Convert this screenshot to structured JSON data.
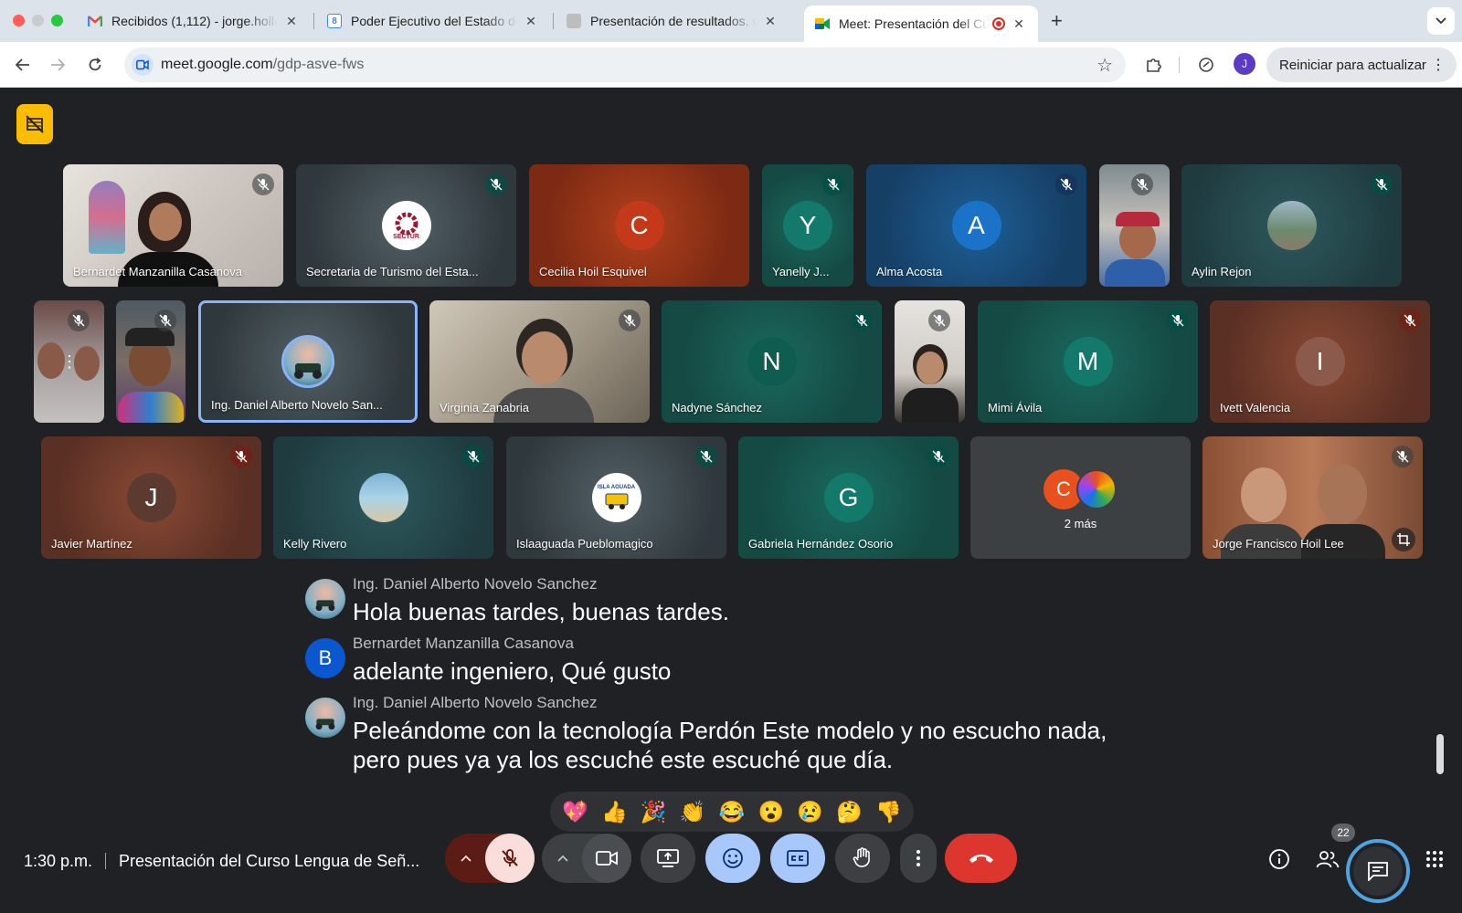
{
  "browser": {
    "tabs": [
      {
        "title": "Recibidos (1,112) - jorge.hoil@",
        "icon": "gmail-icon"
      },
      {
        "title": "Poder Ejecutivo del Estado de",
        "icon": "google-forms-icon"
      },
      {
        "title": "Presentación de resultados. C",
        "icon": "slides-icon"
      },
      {
        "title": "Meet: Presentación del Cu",
        "icon": "meet-icon"
      }
    ],
    "url_domain": "meet.google.com",
    "url_path": "/gdp-asve-fws",
    "profile_initial": "J",
    "update_label": "Reiniciar para actualizar"
  },
  "participants": {
    "row1": [
      {
        "name": "Bernardet Manzanilla Casanova",
        "kind": "video"
      },
      {
        "name": "Secretaria de Turismo del Esta...",
        "kind": "logo",
        "logo_text": "SECTUR"
      },
      {
        "name": "Cecilia Hoil Esquivel",
        "kind": "initial",
        "initial": "C"
      },
      {
        "name": "Yanelly J...",
        "kind": "initial",
        "initial": "Y"
      },
      {
        "name": "Alma Acosta",
        "kind": "initial",
        "initial": "A"
      },
      {
        "name": "",
        "kind": "video"
      },
      {
        "name": "Aylin Rejon",
        "kind": "photo"
      }
    ],
    "row2": [
      {
        "name": "",
        "kind": "video"
      },
      {
        "name": "",
        "kind": "video"
      },
      {
        "name": "Ing. Daniel Alberto Novelo San...",
        "kind": "photo"
      },
      {
        "name": "Virginia Zanabria",
        "kind": "video"
      },
      {
        "name": "Nadyne Sánchez",
        "kind": "initial",
        "initial": "N"
      },
      {
        "name": "",
        "kind": "video"
      },
      {
        "name": "Mimi Ávila",
        "kind": "initial",
        "initial": "M"
      },
      {
        "name": "Ivett Valencia",
        "kind": "initial",
        "initial": "I"
      }
    ],
    "row3": [
      {
        "name": "Javier Martínez",
        "kind": "initial",
        "initial": "J"
      },
      {
        "name": "Kelly Rivero",
        "kind": "photo"
      },
      {
        "name": "Islaaguada Pueblomagico",
        "kind": "logo",
        "logo_text": "ISLA AGUADA"
      },
      {
        "name": "Gabriela Hernández Osorio",
        "kind": "initial",
        "initial": "G"
      },
      {
        "name": "2 más",
        "kind": "more",
        "initial": "C"
      },
      {
        "name": "Jorge Francisco Hoil Lee",
        "kind": "video"
      }
    ]
  },
  "captions": [
    {
      "speaker": "Ing. Daniel Alberto Novelo Sanchez",
      "text": "Hola buenas tardes, buenas tardes.",
      "avatar": "photo"
    },
    {
      "speaker": "Bernardet Manzanilla Casanova",
      "text": "adelante ingeniero, Qué gusto",
      "avatar": "initial",
      "initial": "B"
    },
    {
      "speaker": "Ing. Daniel Alberto Novelo Sanchez",
      "text": "Peleándome con la tecnología Perdón Este modelo y no escucho nada, pero pues ya ya los escuché este escuché que día.",
      "avatar": "photo"
    }
  ],
  "reactions": [
    "💖",
    "👍",
    "🎉",
    "👏",
    "😂",
    "😮",
    "😢",
    "🤔",
    "👎"
  ],
  "bottom_bar": {
    "time": "1:30 p.m.",
    "meeting_title": "Presentación del Curso Lengua de Señ...",
    "people_count": "22"
  },
  "colors": {
    "stage_bg": "#202124",
    "active_tile_border": "#8ab4f8",
    "end_call": "#dc362e",
    "mic_off_bg": "#f9dedc",
    "accent_blue": "#a8c7fa",
    "rec_badge": "#fbbc04"
  }
}
